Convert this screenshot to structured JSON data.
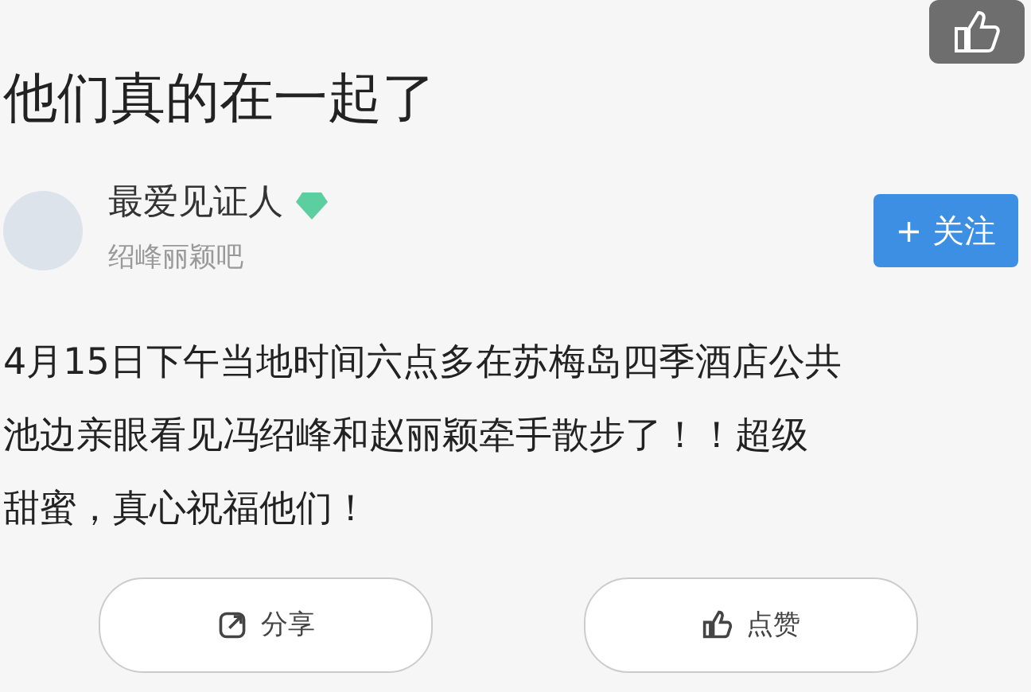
{
  "post": {
    "title": "他们真的在一起了",
    "author": {
      "name": "最爱见证人",
      "verified": true,
      "group": "绍峰丽颖吧"
    },
    "follow_button": {
      "icon": "+",
      "label": "关注"
    },
    "body_lines": [
      "4月15日下午当地时间六点多在苏梅岛四季酒店公共",
      "池边亲眼看见冯绍峰和赵丽颖牵手散步了！！超级",
      "甜蜜，真心祝福他们！"
    ],
    "actions": [
      {
        "kind": "share",
        "label": "分享"
      },
      {
        "kind": "like",
        "label": "点赞"
      }
    ]
  }
}
